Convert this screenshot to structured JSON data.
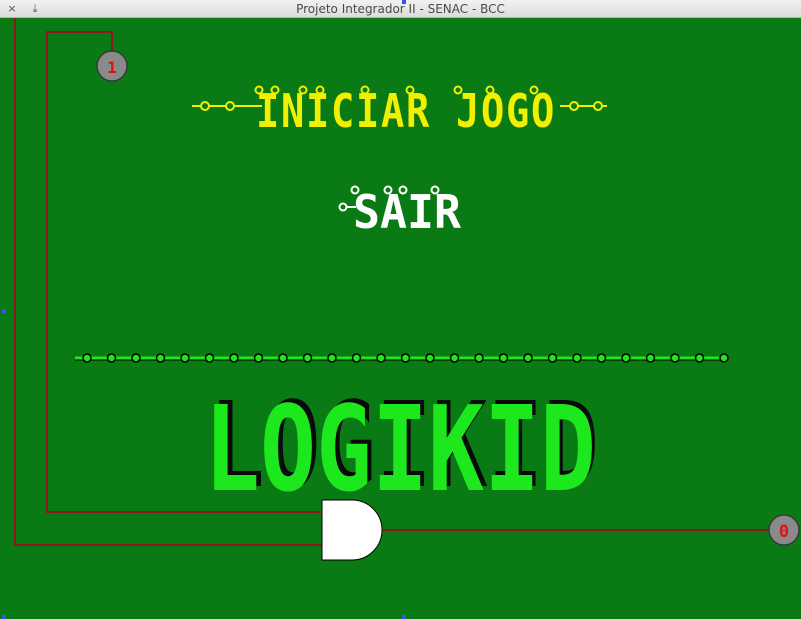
{
  "window": {
    "title": "Projeto Integrador II - SENAC - BCC",
    "close_glyph": "×",
    "minimize_glyph": "⤓"
  },
  "menu": {
    "start_label": "INICIAR JOGO",
    "exit_label": "SAIR"
  },
  "logo": {
    "text": "LOGIKID"
  },
  "circuit": {
    "input_value": "1",
    "output_value": "0",
    "gate": "AND"
  },
  "colors": {
    "background": "#0a7a14",
    "wire": "#8b1a1a",
    "start_text": "#f0f000",
    "exit_text": "#ffffff",
    "logo": "#1de81d",
    "logo_shadow": "#0a0a0a",
    "io_node": "#8a8a8a",
    "io_text": "#e01010"
  }
}
